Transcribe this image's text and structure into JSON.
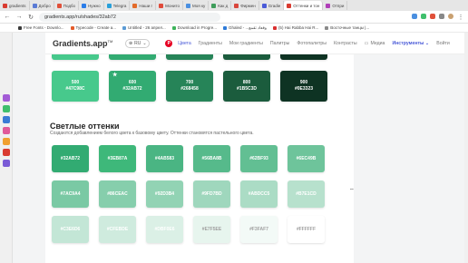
{
  "browser": {
    "tabs": [
      {
        "label": "gradients",
        "color": "#d93b30"
      },
      {
        "label": "Добро",
        "color": "#5b7bd5"
      },
      {
        "label": "Подбо",
        "color": "#e0503a"
      },
      {
        "label": "Нужно",
        "color": "#2b7de9"
      },
      {
        "label": "Telegra",
        "color": "#29a0da"
      },
      {
        "label": "Наши г",
        "color": "#e36b2a"
      },
      {
        "label": "Монито",
        "color": "#e04a3a"
      },
      {
        "label": "Моя ку",
        "color": "#4a8fe0"
      },
      {
        "label": "Как д",
        "color": "#3f9d5b"
      },
      {
        "label": "Фирмен",
        "color": "#d9463c"
      },
      {
        "label": "Gradie",
        "color": "#4a5bd8"
      },
      {
        "label": "Оттенки и тон",
        "color": "#d93b30"
      },
      {
        "label": "Отпри",
        "color": "#b03fb8"
      }
    ],
    "url": "gradients.app/ru/shades/32ab72",
    "bookmarks": [
      {
        "label": "Free Fonts - Downlo...",
        "color": "#3a3a3a"
      },
      {
        "label": "Typecode - Create a...",
        "color": "#e45b2a"
      },
      {
        "label": "Untitled - 26 апрел...",
        "color": "#5b9bd5"
      },
      {
        "label": "Download in Progre...",
        "color": "#3db35a"
      },
      {
        "label": "Ghaled - ...وقعاد تقمع",
        "color": "#2d7ad8"
      },
      {
        "label": "(5) Hai Rabba Hai R...",
        "color": "#d93030"
      },
      {
        "label": "Восточные танцы |...",
        "color": "#8a8a8a"
      }
    ],
    "sidebar_icons": [
      "#a35bd6",
      "#3fbf6c",
      "#3a7bd5",
      "#e05a9a",
      "#f0a030",
      "#d93b30",
      "#7a5bd6"
    ]
  },
  "site": {
    "logo": "Gradients.app",
    "logo_sup": "TM",
    "lang": "RU",
    "nav": [
      "Цвета",
      "Градиенты",
      "Мои градиенты",
      "Палитры",
      "Фотопалитры",
      "Контрасты"
    ],
    "mail": "Медиа",
    "tools": "Инструменты",
    "login": "Войти"
  },
  "top_strip_colors": [
    "#47c98c",
    "#32ab72",
    "#268458",
    "#1b5c3d",
    "#0e3323"
  ],
  "dark_row": [
    {
      "num": "500",
      "hex": "#47C98C",
      "bg": "#47c98c",
      "fg": "#ffffff"
    },
    {
      "num": "600",
      "hex": "#32AB72",
      "bg": "#32ab72",
      "fg": "#ffffff",
      "star": true
    },
    {
      "num": "700",
      "hex": "#268458",
      "bg": "#268458",
      "fg": "#ffffff"
    },
    {
      "num": "800",
      "hex": "#1B5C3D",
      "bg": "#1b5c3d",
      "fg": "#ffffff"
    },
    {
      "num": "900",
      "hex": "#0E3323",
      "bg": "#0e3323",
      "fg": "#ffffff"
    }
  ],
  "tints": {
    "title": "Светлые оттенки",
    "description": "Создаются добавлением белого цвета к базовому цвету. Оттенки становятся пастельного цвета.",
    "rows": [
      [
        {
          "hex": "#32AB72",
          "bg": "#32ab72",
          "fg": "#ffffff"
        },
        {
          "hex": "#3EB87A",
          "bg": "#3eb87a",
          "fg": "#ffffff"
        },
        {
          "hex": "#4AB583",
          "bg": "#4ab583",
          "fg": "#ffffff"
        },
        {
          "hex": "#56BA8B",
          "bg": "#56ba8b",
          "fg": "#ffffff"
        },
        {
          "hex": "#62BF93",
          "bg": "#62bf93",
          "fg": "#ffffff"
        },
        {
          "hex": "#6EC49B",
          "bg": "#6ec49b",
          "fg": "#ffffff"
        }
      ],
      [
        {
          "hex": "#7AC9A4",
          "bg": "#7ac9a4",
          "fg": "#ffffff"
        },
        {
          "hex": "#86CEAC",
          "bg": "#86ceac",
          "fg": "#ffffff"
        },
        {
          "hex": "#92D3B4",
          "bg": "#92d3b4",
          "fg": "#ffffff"
        },
        {
          "hex": "#9FD7BD",
          "bg": "#9fd7bd",
          "fg": "#ffffff"
        },
        {
          "hex": "#ABDCC5",
          "bg": "#abdcc5",
          "fg": "#ffffff"
        },
        {
          "hex": "#B7E1CD",
          "bg": "#b7e1cd",
          "fg": "#ffffff"
        }
      ],
      [
        {
          "hex": "#C3E6D6",
          "bg": "#c3e6d6",
          "fg": "#ffffff"
        },
        {
          "hex": "#CFEBDE",
          "bg": "#cfebde",
          "fg": "#ffffff"
        },
        {
          "hex": "#DBF0E6",
          "bg": "#dbf0e6",
          "fg": "#ffffff"
        },
        {
          "hex": "#E7F5EE",
          "bg": "#e7f5ee",
          "fg": "#a0a0a0"
        },
        {
          "hex": "#F3FAF7",
          "bg": "#f3faf7",
          "fg": "#a0a0a0"
        },
        {
          "hex": "#FFFFFF",
          "bg": "#ffffff",
          "fg": "#a0a0a0"
        }
      ]
    ]
  }
}
